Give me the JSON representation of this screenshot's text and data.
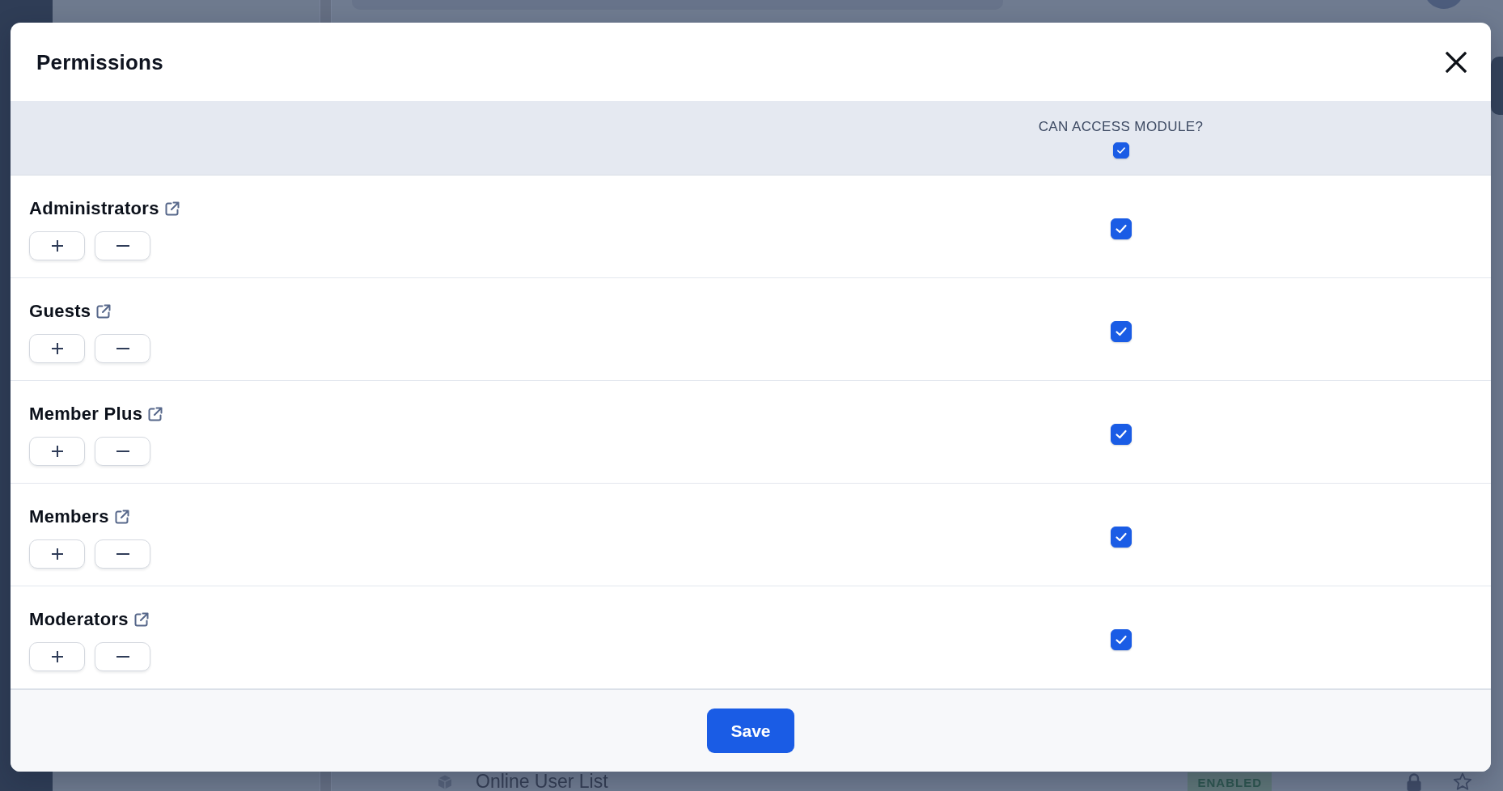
{
  "background": {
    "list_item": {
      "title": "Online User List",
      "status": "ENABLED"
    }
  },
  "dialog": {
    "title": "Permissions",
    "table": {
      "column_header": "CAN ACCESS MODULE?",
      "all_checked": true,
      "rows": [
        {
          "name": "Administrators",
          "can_access": true
        },
        {
          "name": "Guests",
          "can_access": true
        },
        {
          "name": "Member Plus",
          "can_access": true
        },
        {
          "name": "Members",
          "can_access": true
        },
        {
          "name": "Moderators",
          "can_access": true
        }
      ]
    },
    "save_button": "Save"
  }
}
